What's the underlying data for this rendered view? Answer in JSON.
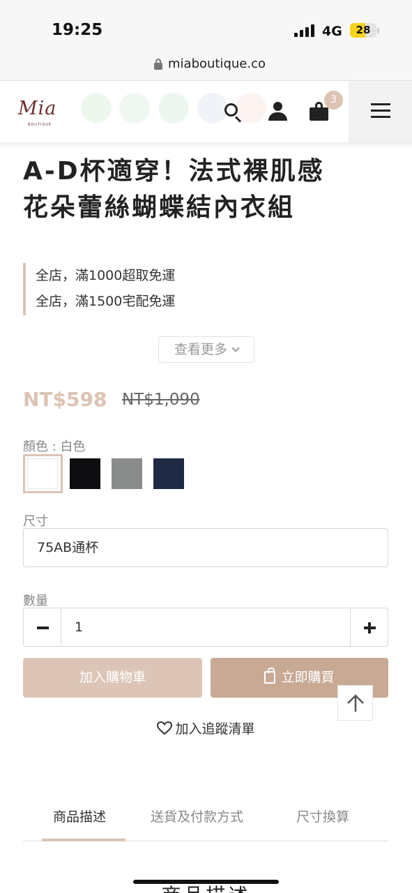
{
  "status_bar": {
    "time": "19:25",
    "network": "4G",
    "battery": "28"
  },
  "browser": {
    "url": "miaboutique.co"
  },
  "header": {
    "logo_text": "Mia",
    "logo_sub": "BOUTIQUE",
    "cart_count": "3",
    "icons": [
      "search-icon",
      "user-icon",
      "cart-icon",
      "menu-icon"
    ]
  },
  "product": {
    "title_line1": "A-D杯適穿！法式裸肌感",
    "title_line2": "花朵蕾絲蝴蝶結內衣組",
    "promos": [
      "全店，滿1000超取免運",
      "全店，滿1500宅配免運"
    ],
    "see_more": "查看更多",
    "price_sale": "NT$598",
    "price_original": "NT$1,090",
    "color_label": "顏色 : 白色",
    "colors": [
      {
        "name": "white",
        "hex": "#ffffff",
        "selected": true
      },
      {
        "name": "black",
        "hex": "#0e0e10",
        "selected": false
      },
      {
        "name": "gray",
        "hex": "#8a8c8c",
        "selected": false
      },
      {
        "name": "navy",
        "hex": "#1f2a45",
        "selected": false
      }
    ],
    "size_label": "尺寸",
    "size_value": "75AB通杯",
    "qty_label": "數量",
    "qty_value": "1"
  },
  "actions": {
    "add_to_cart": "加入購物車",
    "buy_now": "立即購買",
    "wishlist": "加入追蹤清單"
  },
  "tabs": [
    {
      "label": "商品描述",
      "active": true
    },
    {
      "label": "送貨及付款方式",
      "active": false
    },
    {
      "label": "尺寸換算",
      "active": false
    }
  ],
  "section_heading": "商品描述",
  "colors": {
    "accent": "#dcc3b4",
    "buy_button": "#c8a994",
    "add_button": "#dcc5b6",
    "logo": "#6b2e2e"
  }
}
